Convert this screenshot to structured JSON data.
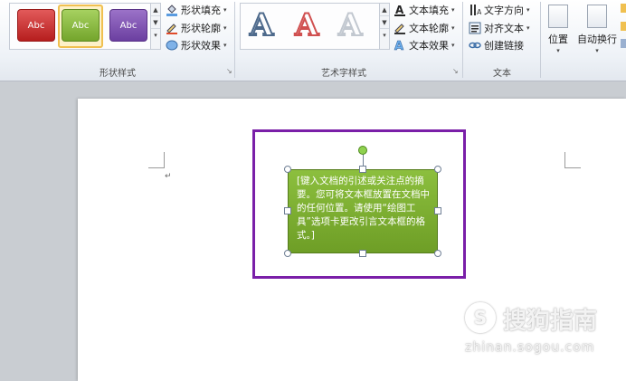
{
  "ribbon": {
    "shape_styles": {
      "label": "形状样式",
      "tiles": [
        {
          "label": "Abc",
          "color": "#c62a2a"
        },
        {
          "label": "Abc",
          "color": "#8bbd45"
        },
        {
          "label": "Abc",
          "color": "#7a4cb0"
        }
      ],
      "commands": {
        "fill": "形状填充",
        "outline": "形状轮廓",
        "effects": "形状效果"
      }
    },
    "wordart_styles": {
      "label": "艺术字样式",
      "letters": [
        "A",
        "A",
        "A"
      ],
      "commands": {
        "fill": "文本填充",
        "outline": "文本轮廓",
        "effects": "文本效果"
      }
    },
    "text": {
      "label": "文本",
      "commands": {
        "direction": "文字方向",
        "align": "对齐文本",
        "link": "创建链接"
      }
    },
    "arrange": {
      "position": "位置",
      "wrap": "自动换行"
    }
  },
  "document": {
    "paragraph_mark": "↵",
    "textbox_text": "[键入文档的引述或关注点的摘要。您可将文本框放置在文档中的任何位置。请使用“绘图工具”选项卡更改引言文本框的格式。]",
    "frame_color": "#7a1fa8",
    "textbox_color": "#7fb234"
  },
  "watermark": {
    "brand": "搜狗指南",
    "url": "zhinan.sogou.com"
  }
}
